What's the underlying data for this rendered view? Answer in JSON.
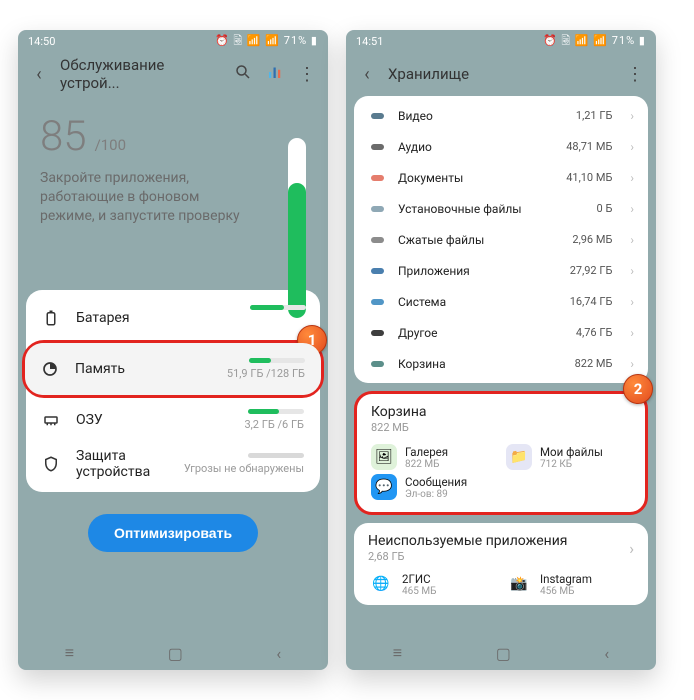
{
  "left": {
    "status": {
      "time": "14:50",
      "right": "⏰ 🗟 📶 📶 71% ▮"
    },
    "appbar": {
      "title": "Обслуживание устрой..."
    },
    "score": {
      "value": "85",
      "max": "/100",
      "advice": "Закройте приложения, работающие в фоновом режиме, и запустите проверку"
    },
    "rows": {
      "battery": {
        "label": "Батарея",
        "value": ""
      },
      "memory": {
        "label": "Память",
        "value": "51,9 ГБ /128 ГБ"
      },
      "ram": {
        "label": "ОЗУ",
        "value": "3,2 ГБ /6 ГБ"
      },
      "security": {
        "label": "Защита устройства",
        "value": "Угрозы не обнаружены"
      }
    },
    "optimize": "Оптимизировать",
    "badge": "1"
  },
  "right": {
    "status": {
      "time": "14:51",
      "right": "⏰ 🗟 📶 📶 71% ▮"
    },
    "appbar": {
      "title": "Хранилище"
    },
    "cats": [
      {
        "label": "Видео",
        "value": "1,21 ГБ",
        "c": "#5a7b8f"
      },
      {
        "label": "Аудио",
        "value": "48,71 МБ",
        "c": "#6b6b6b"
      },
      {
        "label": "Документы",
        "value": "41,10 МБ",
        "c": "#e57d6d"
      },
      {
        "label": "Установочные файлы",
        "value": "0 Б",
        "c": "#8fa8b5"
      },
      {
        "label": "Сжатые файлы",
        "value": "2,96 МБ",
        "c": "#8c8c8c"
      },
      {
        "label": "Приложения",
        "value": "27,92 ГБ",
        "c": "#4a7fae"
      },
      {
        "label": "Система",
        "value": "16,74 ГБ",
        "c": "#5196c6"
      },
      {
        "label": "Другое",
        "value": "4,76 ГБ",
        "c": "#3e3e3e"
      },
      {
        "label": "Корзина",
        "value": "822 МБ",
        "c": "#5c8f8a"
      }
    ],
    "trash": {
      "title": "Корзина",
      "size": "822 МБ",
      "apps": [
        {
          "name": "Галерея",
          "size": "822 МБ",
          "bg": "#dff2da",
          "glyph": "🖼"
        },
        {
          "name": "Мои файлы",
          "size": "712 КБ",
          "bg": "#e5e6f5",
          "glyph": "📁"
        },
        {
          "name": "Сообщения",
          "size": "Эл-ов: 89",
          "bg": "#2196f3",
          "glyph": "💬"
        }
      ]
    },
    "unused": {
      "title": "Неиспользуемые приложения",
      "size": "2,68 ГБ",
      "apps": [
        {
          "name": "2ГИС",
          "size": "465 МБ",
          "bg": "#fff",
          "glyph": "🌐"
        },
        {
          "name": "Instagram",
          "size": "456 МБ",
          "bg": "#fff",
          "glyph": "📸"
        }
      ]
    },
    "badge": "2"
  }
}
